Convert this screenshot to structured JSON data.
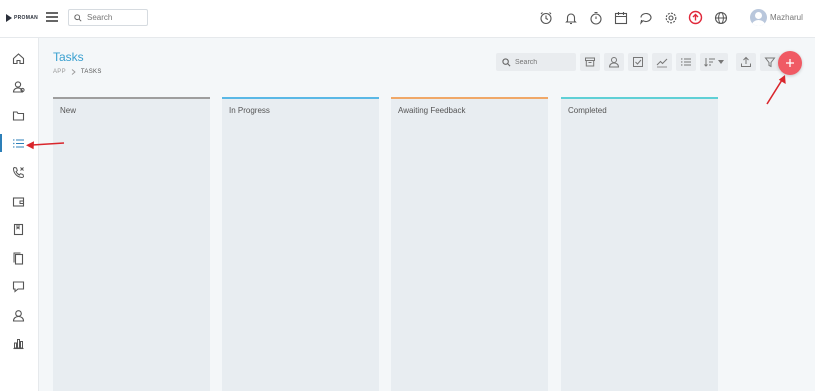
{
  "app": {
    "logo_text": "PROMAN"
  },
  "topbar": {
    "search_placeholder": "Search",
    "icons": [
      "alarm-icon",
      "bell-icon",
      "timer-icon",
      "calendar-icon",
      "chat-icon",
      "gear-icon",
      "upgrade-icon",
      "globe-icon"
    ],
    "user_name": "Mazharul"
  },
  "sidebar": {
    "items": [
      "home-icon",
      "contacts-icon",
      "folder-icon",
      "tasks-icon",
      "calls-icon",
      "wallet-icon",
      "book-icon",
      "documents-icon",
      "support-icon",
      "user-icon",
      "reports-icon"
    ],
    "active_index": 3
  },
  "page": {
    "title": "Tasks",
    "breadcrumb": [
      "APP",
      "TASKS"
    ]
  },
  "toolbar": {
    "search_placeholder": "Search",
    "buttons": [
      "archive-icon",
      "assignee-icon",
      "checkbox-icon",
      "trend-icon",
      "list-icon",
      "sort-icon",
      "export-icon",
      "filter-icon"
    ]
  },
  "columns": [
    {
      "label": "New",
      "color": "#9e9e9e"
    },
    {
      "label": "In Progress",
      "color": "#5ab8e6"
    },
    {
      "label": "Awaiting Feedback",
      "color": "#f0a868"
    },
    {
      "label": "Completed",
      "color": "#5fd0d6"
    }
  ],
  "colors": {
    "accent": "#3aa0d0",
    "fab": "#f05a64",
    "annotation": "#d9262c"
  }
}
